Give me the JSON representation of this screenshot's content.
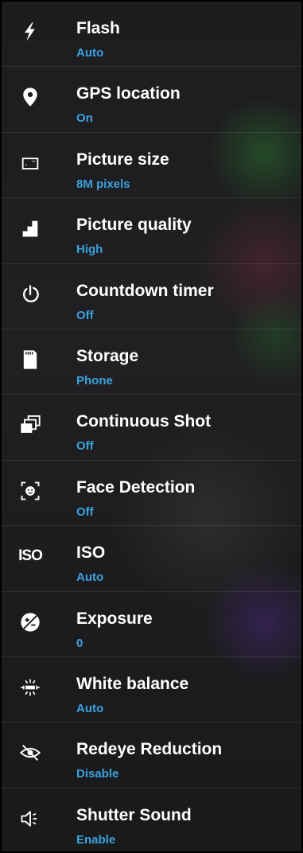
{
  "settings": [
    {
      "label": "Flash",
      "value": "Auto",
      "icon": "flash-icon"
    },
    {
      "label": "GPS location",
      "value": "On",
      "icon": "location-pin-icon"
    },
    {
      "label": "Picture size",
      "value": "8M pixels",
      "icon": "picture-size-icon"
    },
    {
      "label": "Picture quality",
      "value": "High",
      "icon": "picture-quality-icon"
    },
    {
      "label": "Countdown timer",
      "value": "Off",
      "icon": "timer-icon"
    },
    {
      "label": "Storage",
      "value": "Phone",
      "icon": "sd-card-icon"
    },
    {
      "label": "Continuous Shot",
      "value": "Off",
      "icon": "continuous-shot-icon"
    },
    {
      "label": "Face Detection",
      "value": "Off",
      "icon": "face-detection-icon"
    },
    {
      "label": "ISO",
      "value": "Auto",
      "icon": "iso-icon",
      "icon_text": "ISO"
    },
    {
      "label": "Exposure",
      "value": "0",
      "icon": "exposure-icon"
    },
    {
      "label": "White balance",
      "value": "Auto",
      "icon": "white-balance-icon"
    },
    {
      "label": "Redeye Reduction",
      "value": "Disable",
      "icon": "redeye-icon"
    },
    {
      "label": "Shutter Sound",
      "value": "Enable",
      "icon": "shutter-sound-icon"
    }
  ],
  "colors": {
    "label": "#ffffff",
    "value": "#3aa2e0",
    "background": "#1e1e20"
  }
}
